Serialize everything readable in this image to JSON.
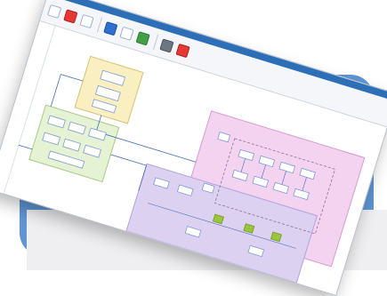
{
  "window": {
    "title": ""
  },
  "toolbar": {
    "buttons": [
      {
        "icon": "open-icon",
        "color": "#ffffff"
      },
      {
        "icon": "close-icon",
        "color": "#e53935"
      },
      {
        "icon": "save-icon",
        "color": "#ffffff"
      },
      {
        "icon": "layout-icon",
        "color": "#2f6fd1"
      },
      {
        "icon": "connect-icon",
        "color": "#ffffff"
      },
      {
        "icon": "run-icon",
        "color": "#43a047"
      },
      {
        "icon": "export-icon",
        "color": "#6e7781"
      },
      {
        "icon": "flag-icon",
        "color": "#e53935"
      }
    ]
  },
  "diagram": {
    "groups": [
      {
        "name": "yellow-group",
        "fill": "#f9efc1",
        "stroke": "#d6c178"
      },
      {
        "name": "green-group",
        "fill": "#e5f2d3",
        "stroke": "#a9c98a"
      },
      {
        "name": "pink-group",
        "fill": "#f3d3ef",
        "stroke": "#d79ad0"
      },
      {
        "name": "lavender-group",
        "fill": "#ddd1f1",
        "stroke": "#b5a2dd"
      }
    ],
    "accent_colors": {
      "node": "#7d9bd1",
      "link": "#3f6fb6",
      "highlight": "#9bc53d"
    }
  },
  "status": {
    "page_label": ""
  }
}
